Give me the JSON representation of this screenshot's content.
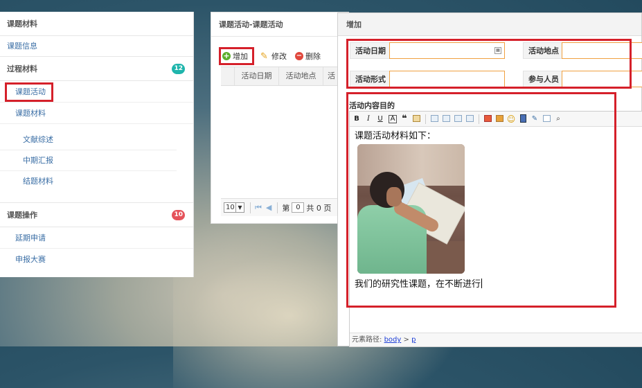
{
  "sidebar": {
    "section1_title": "课题材料",
    "link_info": "课题信息",
    "section2_title": "过程材料",
    "section2_badge": "12",
    "item_activity": "课题活动",
    "item_material": "课题材料",
    "sub_items": [
      "文献综述",
      "中期汇报",
      "结题材料"
    ],
    "section3_title": "课题操作",
    "section3_badge": "10",
    "op_items": [
      "延期申请",
      "申报大赛"
    ]
  },
  "midpanel": {
    "title": "课题活动-课题活动",
    "toolbar": {
      "add": "增加",
      "edit": "修改",
      "delete": "删除"
    },
    "columns": [
      "活动日期",
      "活动地点",
      "活"
    ],
    "pager": {
      "page_size": "10",
      "page_label": "第",
      "page_value": "0",
      "total_text": "共 0 页"
    }
  },
  "dialog": {
    "title": "增加",
    "fields": {
      "date_label": "活动日期",
      "place_label": "活动地点",
      "form_label": "活动形式",
      "people_label": "参与人员"
    },
    "content_label": "活动内容目的",
    "editor": {
      "line1": "课题活动材料如下：",
      "line2": "我们的研究性课题，在不断进行",
      "status_prefix": "元素路径:",
      "path_body": "body",
      "path_sep": ">",
      "path_p": "p"
    }
  },
  "colors": {
    "highlight": "#d5202a",
    "link": "#3a6ea5",
    "badge_teal": "#1fb5ac",
    "badge_red": "#e5535b",
    "input_border": "#f0a040"
  }
}
